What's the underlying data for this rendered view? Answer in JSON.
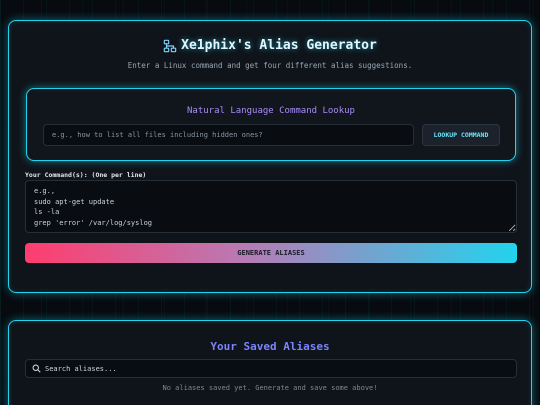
{
  "header": {
    "title": "Xe1phix's Alias Generator",
    "subtitle": "Enter a Linux command and get four different alias suggestions.",
    "icon": "sitemap-icon"
  },
  "lookup": {
    "title": "Natural Language Command Lookup",
    "placeholder": "e.g., how to list all files including hidden ones?",
    "button_label": "LOOKUP COMMAND"
  },
  "commands": {
    "label": "Your Command(s): (One per line)",
    "placeholder_lines": [
      "e.g.,",
      "sudo apt-get update",
      "ls -la",
      "grep 'error' /var/log/syslog"
    ]
  },
  "generate": {
    "button_label": "GENERATE ALIASES"
  },
  "saved": {
    "title": "Your Saved Aliases",
    "search_placeholder": "Search aliases...",
    "empty_message": "No aliases saved yet. Generate and save some above!"
  },
  "colors": {
    "accent": "#22d3ee",
    "lookup_title": "#a78bfa",
    "saved_title": "#7c83ff",
    "gradient_start": "#ff3d6e",
    "gradient_end": "#22d3ee"
  }
}
